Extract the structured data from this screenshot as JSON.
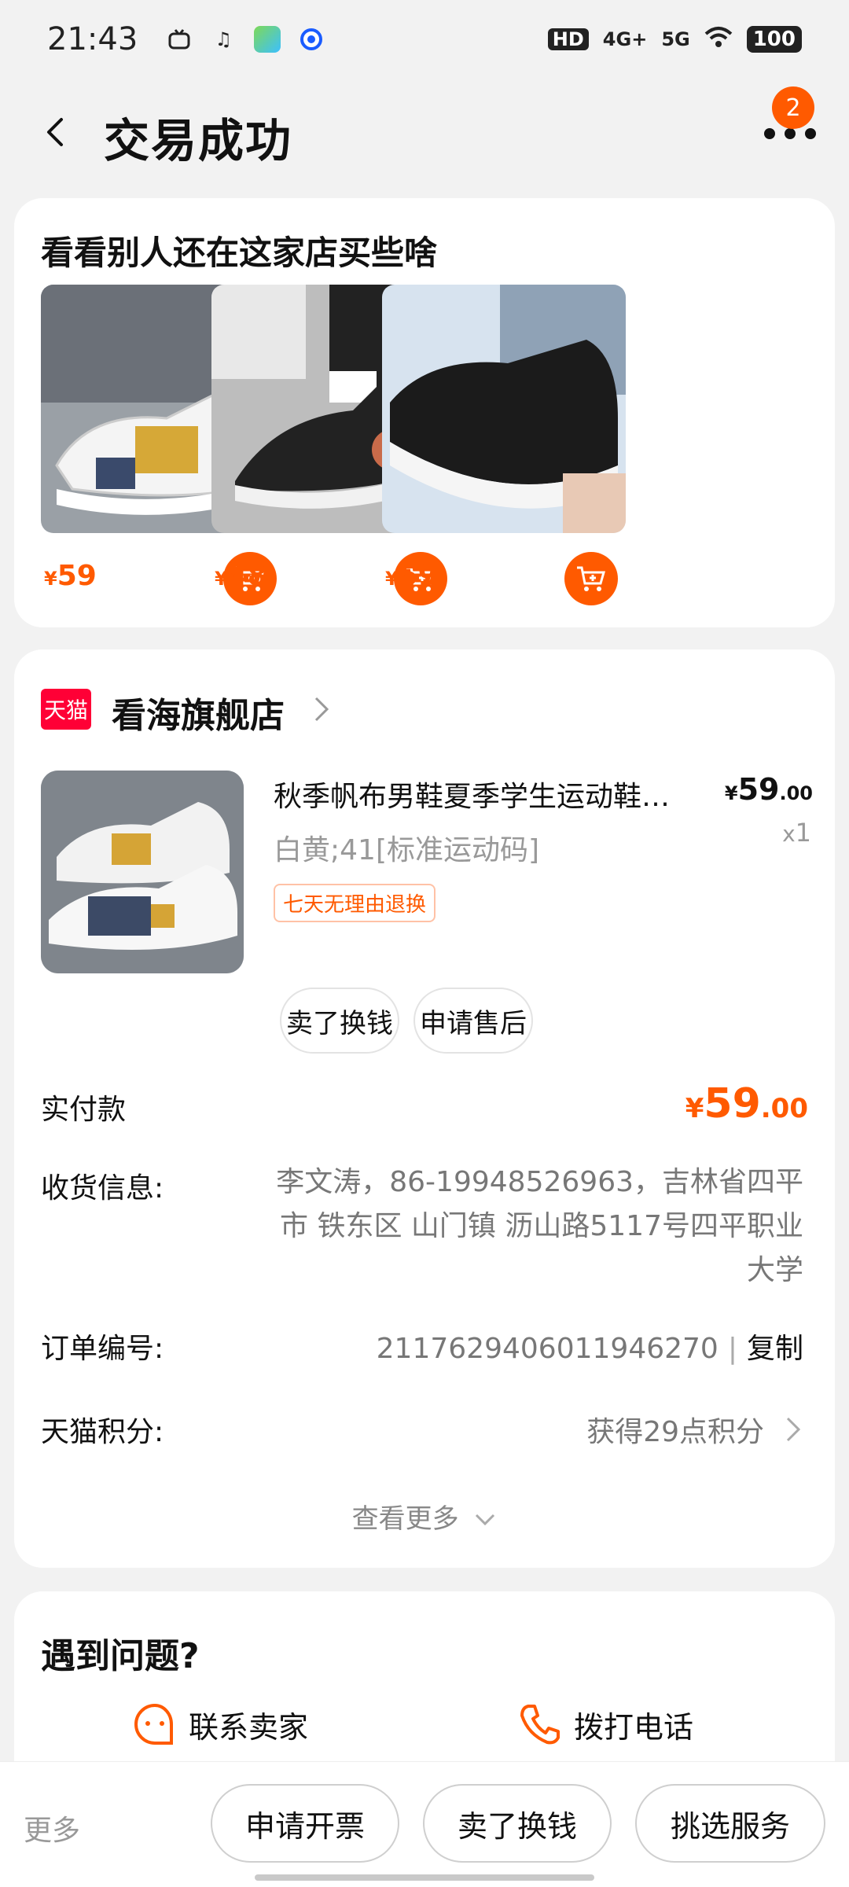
{
  "status_bar": {
    "time": "21:43",
    "battery": "100",
    "net1": "4G+",
    "net2": "5G",
    "hd": "HD"
  },
  "header": {
    "title": "交易成功",
    "badge_count": "2"
  },
  "recommend": {
    "title": "看看别人还在这家店买些啥",
    "items": [
      {
        "currency": "¥",
        "price": "59"
      },
      {
        "currency": "¥",
        "price": "48"
      },
      {
        "currency": "¥",
        "price": "59"
      }
    ]
  },
  "order": {
    "store_logo": "天猫",
    "store_name": "看海旗舰店",
    "product": {
      "title": "秋季帆布男鞋夏季学生运动鞋子男休闲板鞋",
      "currency": "¥",
      "price_int": "59",
      "price_dec": ".00",
      "qty_prefix": "x",
      "qty": "1",
      "spec": "白黄;41[标准运动码]",
      "tag": "七天无理由退换"
    },
    "actions": {
      "sell": "卖了换钱",
      "after_sale": "申请售后"
    },
    "paid": {
      "label": "实付款",
      "currency": "¥",
      "int": "59",
      "dec": ".00"
    },
    "shipping": {
      "label": "收货信息:",
      "value": "李文涛，86-19948526963，吉林省四平市 铁东区 山门镇 沥山路5117号四平职业大学"
    },
    "order_no": {
      "label": "订单编号:",
      "value": "2117629406011946270",
      "sep": "|",
      "copy": "复制"
    },
    "points": {
      "label": "天猫积分:",
      "value": "获得29点积分"
    },
    "see_more": "查看更多"
  },
  "problem": {
    "title": "遇到问题?",
    "contact_seller": "联系卖家",
    "call": "拨打电话"
  },
  "bottom_bar": {
    "more": "更多",
    "invoice": "申请开票",
    "sell": "卖了换钱",
    "service": "挑选服务"
  },
  "colors": {
    "accent": "#ff5a00",
    "tmall": "#ff0036"
  }
}
